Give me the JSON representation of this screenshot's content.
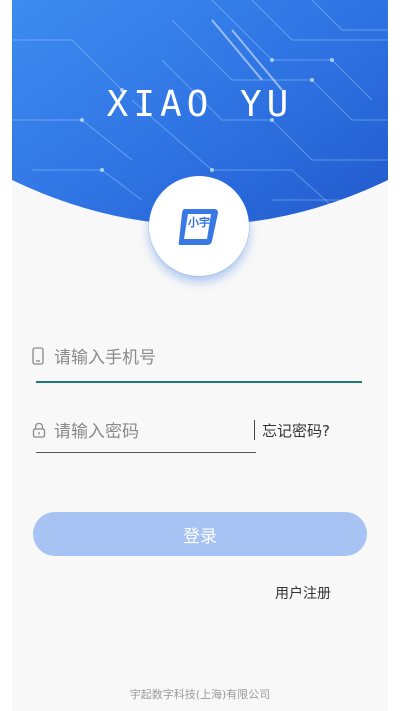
{
  "header": {
    "brand_title": "XIAO YU"
  },
  "logo": {
    "text": "小宇"
  },
  "form": {
    "phone_placeholder": "请输入手机号",
    "password_placeholder": "请输入密码",
    "forgot_password": "忘记密码?",
    "login_button": "登录",
    "register_link": "用户注册"
  },
  "footer": {
    "company": "宇起数字科技(上海)有限公司"
  },
  "colors": {
    "hero_blue": "#2f6fdc",
    "button_bg": "#a7c3f3",
    "active_underline": "#1f7d74",
    "page_bg": "#f8f8f8"
  },
  "icons": [
    "phone-icon",
    "lock-icon",
    "app-logo-icon"
  ]
}
